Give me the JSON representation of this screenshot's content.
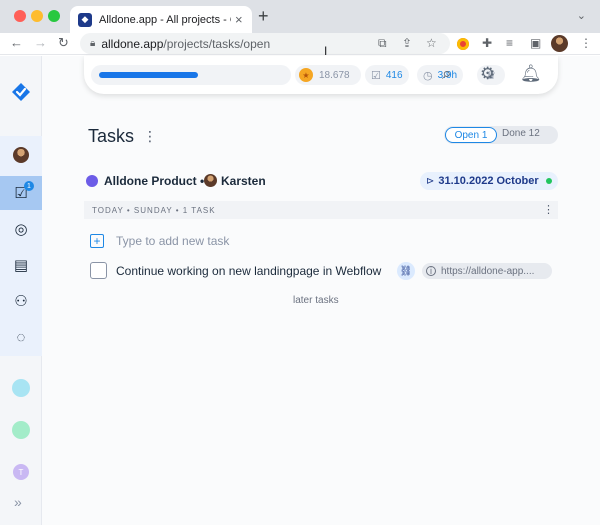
{
  "browser": {
    "tab_title": "Alldone.app - All projects - Op",
    "tab_close": "×",
    "new_tab": "+",
    "tab_chevron": "⌄",
    "url_host": "alldone.app",
    "url_path": "/projects/tasks/open",
    "back": "←",
    "forward": "→",
    "reload": "↻",
    "menu": "⋮"
  },
  "topbar": {
    "progress_fraction": 0.54,
    "gold_value": "18.678",
    "tasks_value": "416",
    "time_value": "3.9h"
  },
  "sidebar": {
    "badge": "1",
    "projects": [
      {
        "color": "#a8e4f3"
      },
      {
        "color": "#a3ecc9"
      },
      {
        "color": "#c9b8f3",
        "letter": "T"
      }
    ],
    "expand": "»"
  },
  "main": {
    "title": "Tasks",
    "title_menu": "⋮",
    "tabs": {
      "open": "Open 1",
      "done": "Done 12"
    },
    "project": {
      "name": "Alldone Product",
      "separator": "•",
      "owner": "Karsten",
      "date": "31.10.2022 October"
    },
    "day_header": "TODAY • SUNDAY • 1 TASK",
    "day_menu": "⋮",
    "add_placeholder": "Type to add new task",
    "task": {
      "text": "Continue working on new landingpage in Webflow",
      "link": "https://alldone-app...."
    },
    "later": "later tasks"
  }
}
